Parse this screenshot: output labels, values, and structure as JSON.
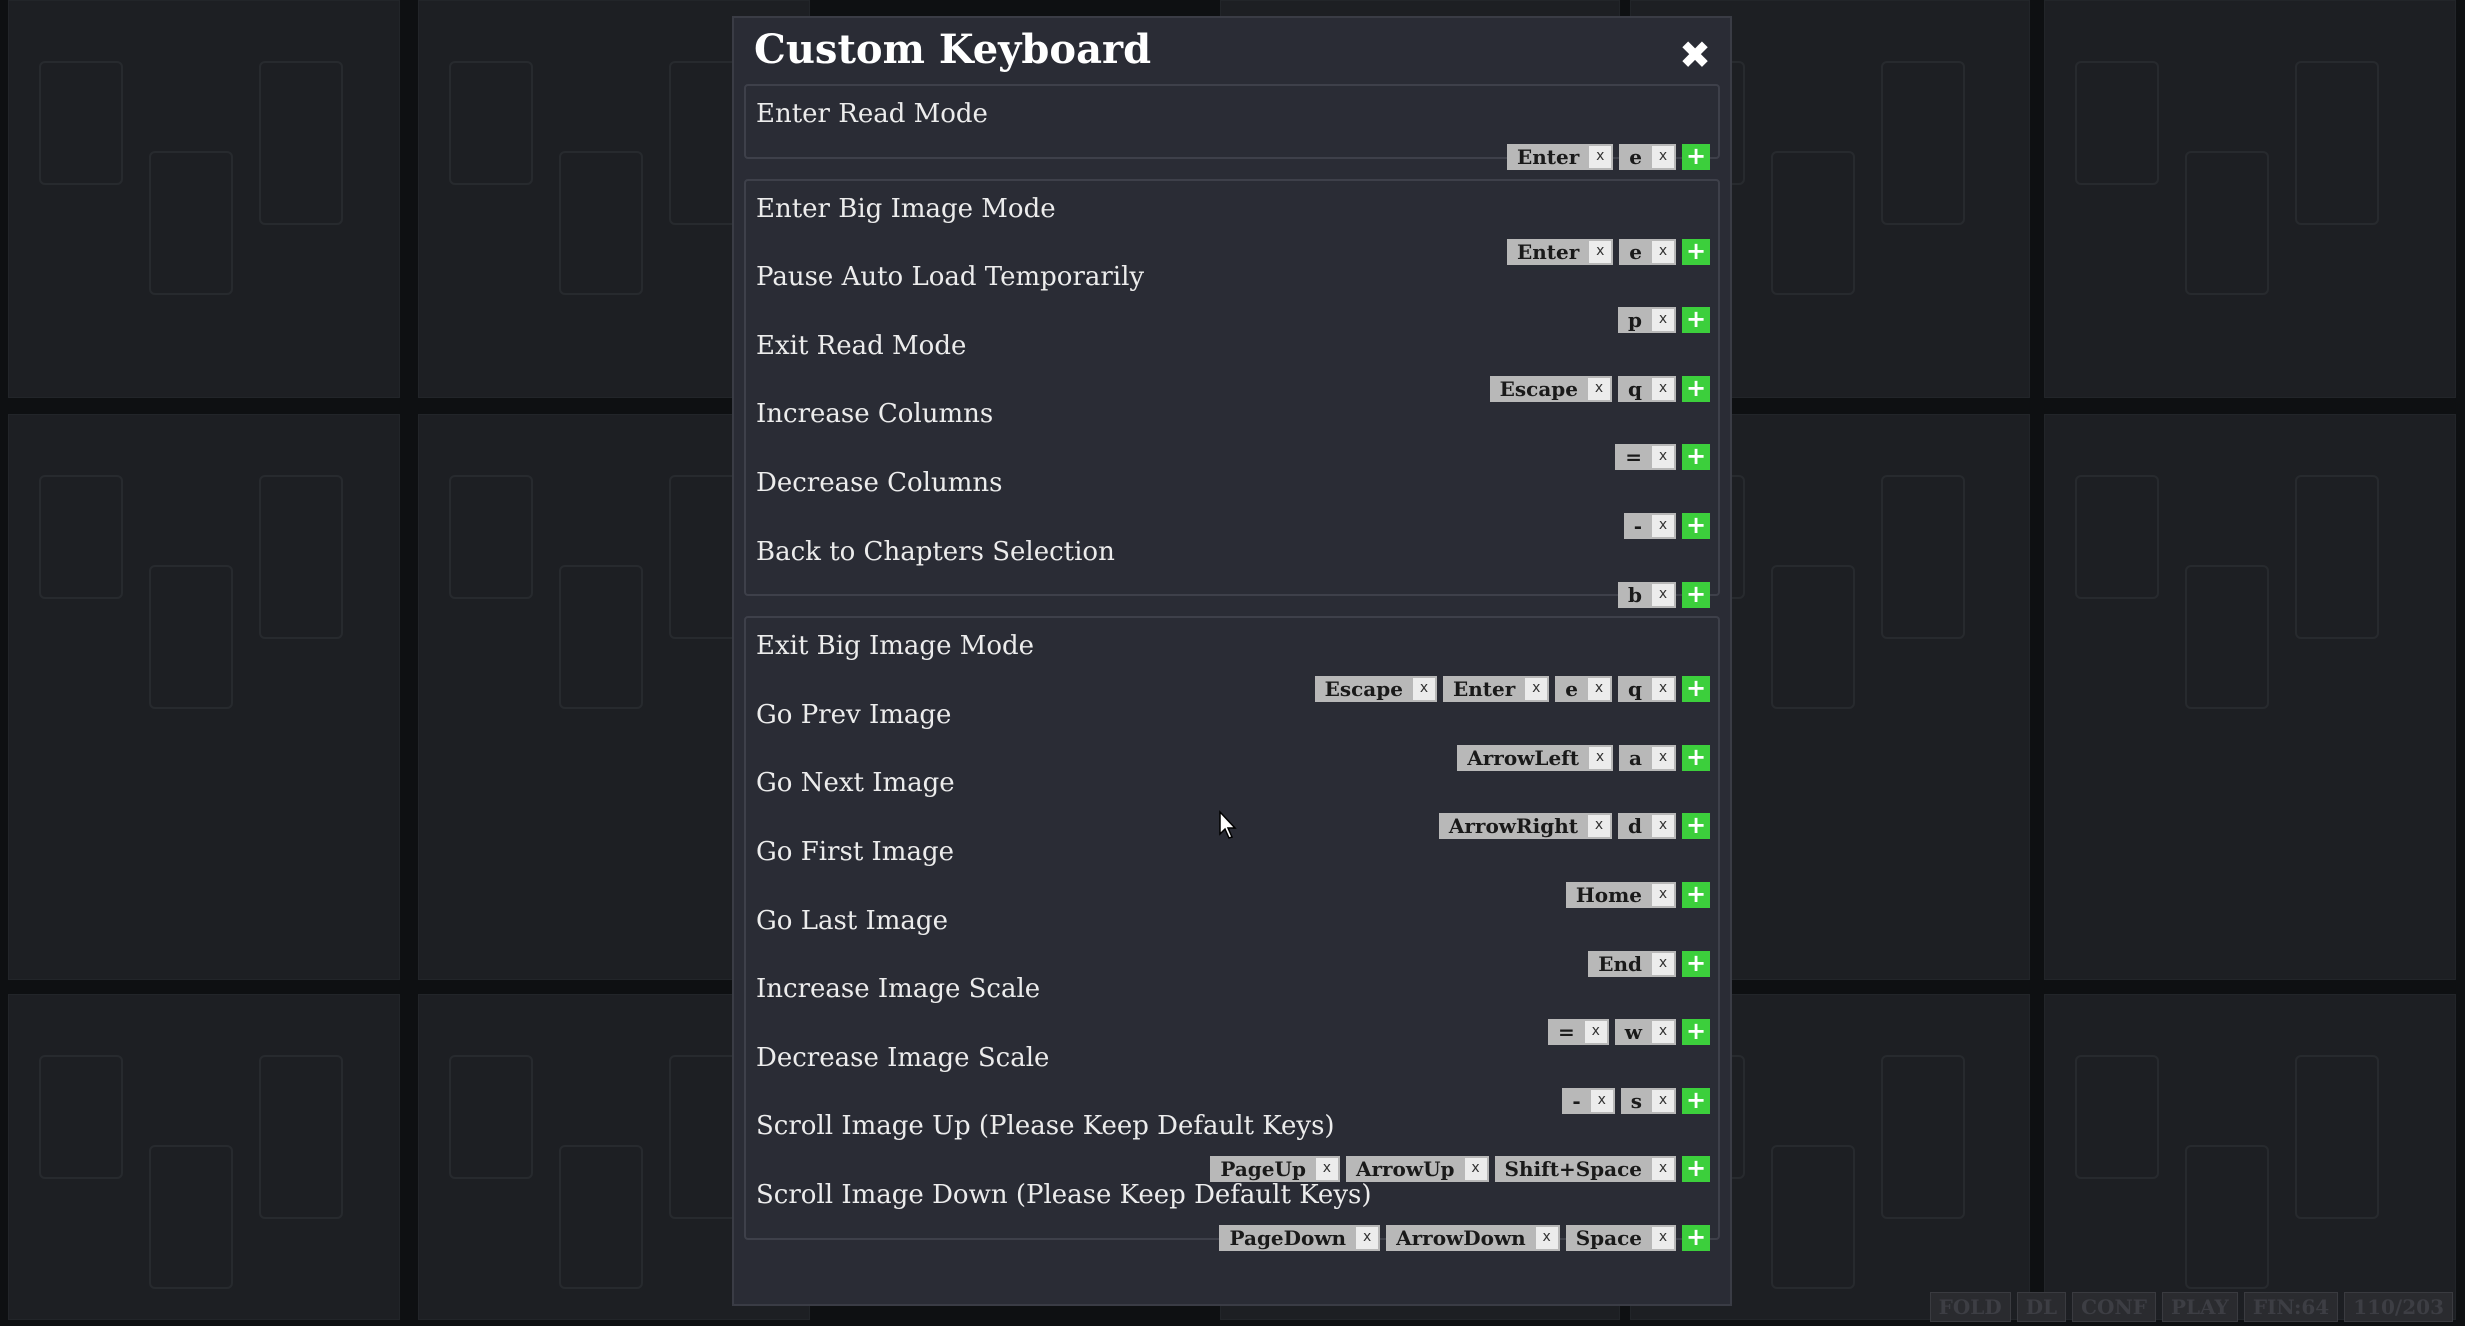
{
  "dialog": {
    "title": "Custom Keyboard",
    "close_icon": "close-icon"
  },
  "status_bar": [
    "FOLD",
    "DL",
    "CONF",
    "PLAY",
    "FIN:64",
    "110/203"
  ],
  "sections": [
    {
      "actions": [
        {
          "label": "Enter Read Mode",
          "keys": [
            "Enter",
            "e"
          ]
        }
      ]
    },
    {
      "actions": [
        {
          "label": "Enter Big Image Mode",
          "keys": [
            "Enter",
            "e"
          ]
        },
        {
          "label": "Pause Auto Load Temporarily",
          "keys": [
            "p"
          ]
        },
        {
          "label": "Exit Read Mode",
          "keys": [
            "Escape",
            "q"
          ]
        },
        {
          "label": "Increase Columns",
          "keys": [
            "="
          ]
        },
        {
          "label": "Decrease Columns",
          "keys": [
            "-"
          ]
        },
        {
          "label": "Back to Chapters Selection",
          "keys": [
            "b"
          ]
        }
      ]
    },
    {
      "actions": [
        {
          "label": "Exit Big Image Mode",
          "keys": [
            "Escape",
            "Enter",
            "e",
            "q"
          ]
        },
        {
          "label": "Go Prev Image",
          "keys": [
            "ArrowLeft",
            "a"
          ]
        },
        {
          "label": "Go Next Image",
          "keys": [
            "ArrowRight",
            "d"
          ]
        },
        {
          "label": "Go First Image",
          "keys": [
            "Home"
          ]
        },
        {
          "label": "Go Last Image",
          "keys": [
            "End"
          ]
        },
        {
          "label": "Increase Image Scale",
          "keys": [
            "=",
            "w"
          ]
        },
        {
          "label": "Decrease Image Scale",
          "keys": [
            "-",
            "s"
          ]
        },
        {
          "label": "Scroll Image Up (Please Keep Default Keys)",
          "keys": [
            "PageUp",
            "ArrowUp",
            "Shift+Space"
          ]
        },
        {
          "label": "Scroll Image Down (Please Keep Default Keys)",
          "keys": [
            "PageDown",
            "ArrowDown",
            "Space"
          ]
        }
      ]
    }
  ],
  "remove_key_label": "x",
  "add_key_label": "+"
}
